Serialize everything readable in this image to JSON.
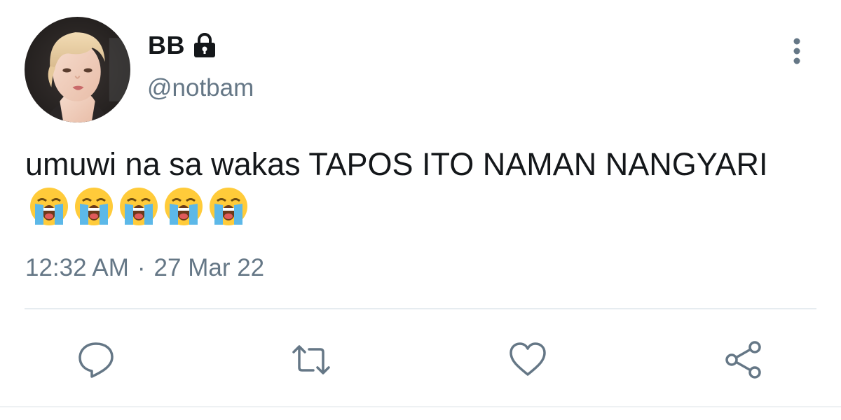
{
  "user": {
    "display_name": "BB",
    "handle": "@notbam",
    "protected_icon": "lock-icon",
    "avatar_icon": "profile-photo"
  },
  "tweet": {
    "text": "umuwi na sa wakas TAPOS ITO NAMAN NANGYARI",
    "emoji": [
      "loudly-crying-face",
      "loudly-crying-face",
      "loudly-crying-face",
      "loudly-crying-face",
      "loudly-crying-face"
    ],
    "time": "12:32 AM",
    "separator": "·",
    "date": "27 Mar 22"
  },
  "actions": [
    {
      "icon": "reply-icon"
    },
    {
      "icon": "retweet-icon"
    },
    {
      "icon": "like-icon"
    },
    {
      "icon": "share-icon"
    }
  ],
  "menu_icon": "more-vertical-icon",
  "colors": {
    "text_primary": "#14171a",
    "text_secondary": "#657786",
    "icon_gray": "#657786",
    "divider": "#e6ecf0"
  }
}
